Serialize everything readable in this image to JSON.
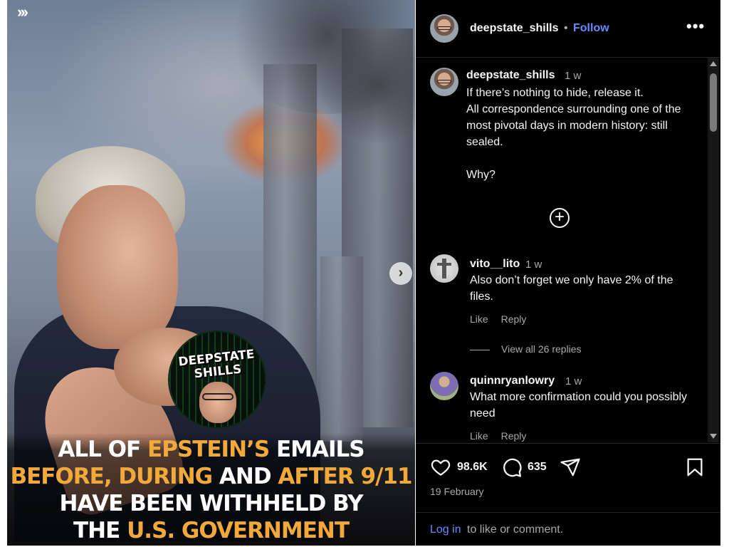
{
  "media": {
    "carousel_marker": "›››",
    "next_button_glyph": "›",
    "logo_text_line1": "DEEPSTATE",
    "logo_text_line2": "SHILLS",
    "headline": {
      "line1_a": "ALL OF ",
      "line1_b": "EPSTEIN’S",
      "line1_c": " EMAILS",
      "line2_a": "BEFORE, DURING",
      "line2_b": " AND ",
      "line2_c": "AFTER 9/11",
      "line3": "HAVE BEEN WITHHELD BY",
      "line4_a": "THE ",
      "line4_b": "U.S. GOVERNMENT"
    },
    "accent_color": "#f2a93b"
  },
  "header": {
    "username": "deepstate_shills",
    "dot": "•",
    "follow_label": "Follow",
    "more_glyph": "•••"
  },
  "caption": {
    "username": "deepstate_shills",
    "time": "1 w",
    "text": "If there’s nothing to hide, release it.\nAll correspondence surrounding one of the most pivotal days in modern history: still sealed.\n\nWhy?",
    "more_comments_glyph": "+"
  },
  "comments": [
    {
      "username": "vito__lito",
      "time": "1 w",
      "text": "Also don’t forget we only have 2% of the files.",
      "like_label": "Like",
      "reply_label": "Reply",
      "view_replies": "View all 26 replies"
    },
    {
      "username": "quinnryanlowry",
      "time": "1 w",
      "text": "What more confirmation could you possibly need",
      "like_label": "Like",
      "reply_label": "Reply"
    }
  ],
  "actions": {
    "likes": "98.6K",
    "comments": "635",
    "date": "19 February"
  },
  "login": {
    "link": "Log in",
    "rest": "to like or comment."
  },
  "colors": {
    "panel_bg": "#000000",
    "link_blue": "#6a8bff",
    "muted": "#a8a8a8"
  }
}
